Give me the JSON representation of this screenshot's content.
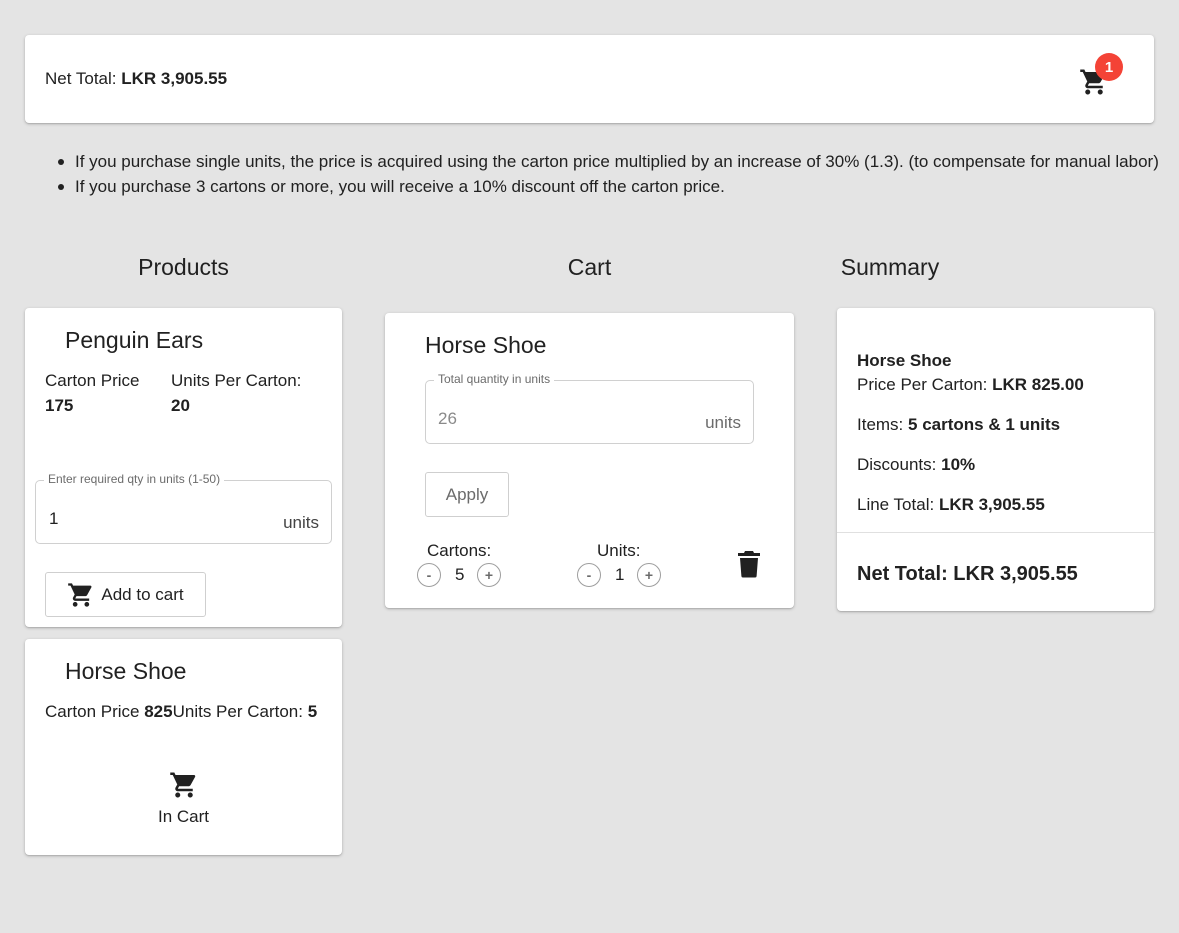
{
  "header": {
    "net_total_label": "Net Total:",
    "net_total_value": "LKR 3,905.55",
    "cart_icon": "shopping-cart-icon",
    "cart_badge": "1",
    "badge_color": "#f44336"
  },
  "rules": [
    "If you purchase single units, the price is acquired using the carton price multiplied by an increase of 30% (1.3). (to compensate for manual labor)",
    "If you purchase 3 cartons or more, you will receive a 10% discount off the carton price."
  ],
  "columns": {
    "products_title": "Products",
    "cart_title": "Cart",
    "summary_title": "Summary"
  },
  "products": [
    {
      "name": "Penguin Ears",
      "carton_price_label": "Carton Price",
      "carton_price": "175",
      "units_per_carton_label": "Units Per Carton:",
      "units_per_carton": "20",
      "qty_legend": "Enter required qty in units (1-50)",
      "qty_value": "1",
      "qty_suffix": "units",
      "add_button_label": "Add to cart"
    },
    {
      "name": "Horse Shoe",
      "carton_price_label": "Carton Price",
      "carton_price": "825",
      "units_per_carton_label": "Units Per Carton:",
      "units_per_carton": "5",
      "status_label": "In Cart"
    }
  ],
  "cart": {
    "item_name": "Horse Shoe",
    "qty_legend": "Total quantity in units",
    "qty_placeholder": "26",
    "qty_suffix": "units",
    "apply_label": "Apply",
    "cartons_label": "Cartons:",
    "cartons_value": "5",
    "units_label": "Units:",
    "units_value": "1",
    "minus": "-",
    "plus": "+",
    "delete_icon": "trash-icon"
  },
  "summary": {
    "item_name": "Horse Shoe",
    "price_per_carton_label": "Price Per Carton:",
    "price_per_carton_value": "LKR 825.00",
    "items_label": "Items:",
    "items_value": "5 cartons & 1 units",
    "discounts_label": "Discounts:",
    "discounts_value": "10%",
    "line_total_label": "Line Total:",
    "line_total_value": "LKR 3,905.55",
    "net_total_label": "Net Total:",
    "net_total_value": "LKR 3,905.55"
  }
}
